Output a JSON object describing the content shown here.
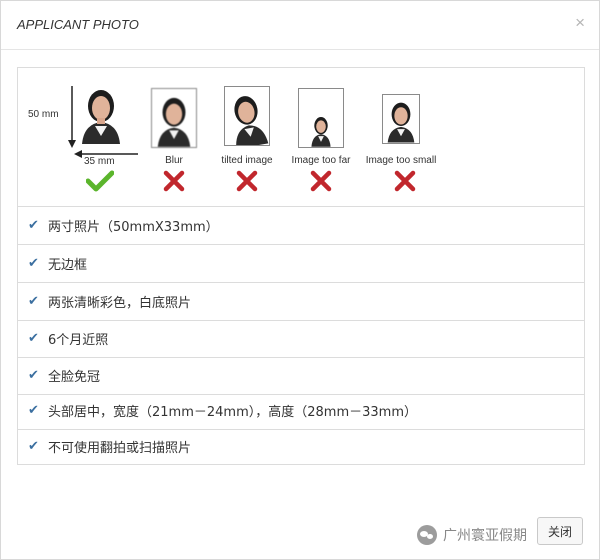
{
  "dialog": {
    "title": "APPLICANT PHOTO",
    "close_glyph": "×",
    "close_button_label": "关闭"
  },
  "examples": {
    "height_label": "50 mm",
    "width_label": "35 mm",
    "items": [
      {
        "caption": "",
        "status": "ok",
        "icon": "green-check-icon"
      },
      {
        "caption": "Blur",
        "status": "bad",
        "icon": "red-x-icon"
      },
      {
        "caption": "tilted image",
        "status": "bad",
        "icon": "red-x-icon"
      },
      {
        "caption": "Image too far",
        "status": "bad",
        "icon": "red-x-icon"
      },
      {
        "caption": "Image too small",
        "status": "bad",
        "icon": "red-x-icon"
      }
    ]
  },
  "requirements": [
    "两寸照片（50mmX33mm）",
    "无边框",
    "两张清晰彩色，白底照片",
    "6个月近照",
    "全脸免冠",
    "头部居中，宽度（21mm－24mm），高度（28mm－33mm）",
    "不可使用翻拍或扫描照片"
  ],
  "watermark": {
    "text": "广州寰亚假期"
  },
  "colors": {
    "check": "#3b6fa0",
    "ok": "#5bb52c",
    "bad": "#c1272d"
  }
}
